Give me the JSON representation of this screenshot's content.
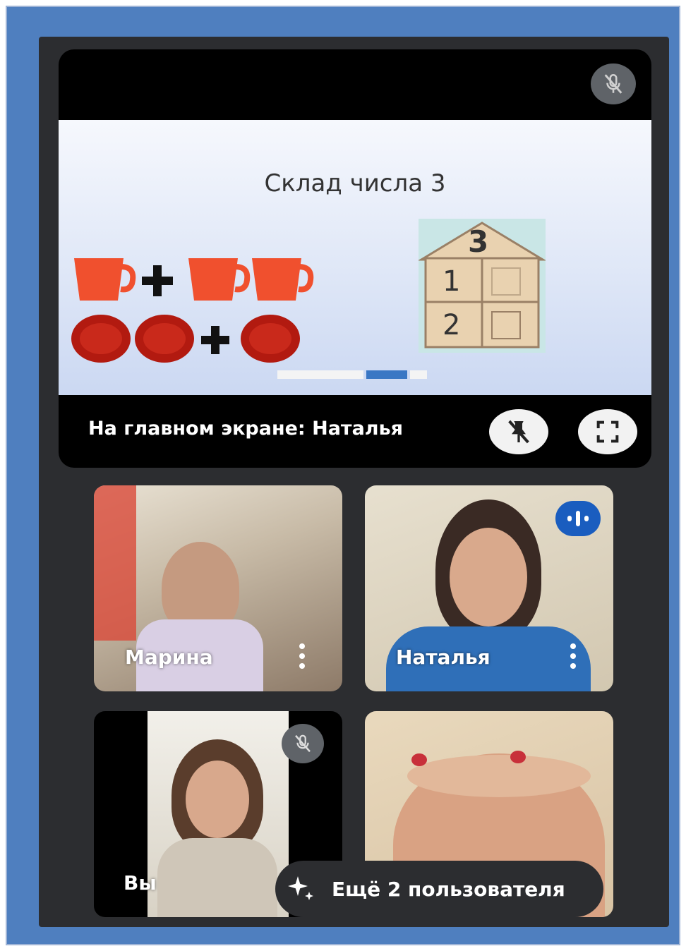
{
  "presentation": {
    "slide_title": "Склад числа 3",
    "house_top_number": "3",
    "house_rows": [
      "1",
      "2"
    ],
    "caption": "На главном экране: Наталья",
    "icons": {
      "top_right": "mic-off-icon",
      "pin": "unpin-icon",
      "fullscreen": "fullscreen-icon"
    }
  },
  "participants": [
    {
      "name": "Марина",
      "icon": "more-options-icon"
    },
    {
      "name": "Наталья",
      "icon": "more-options-icon",
      "status": "speaking"
    },
    {
      "name": "Вы",
      "icon": "mic-off-icon"
    },
    {
      "name": ""
    }
  ],
  "more_users": {
    "label": "Ещё 2 пользователя",
    "icon": "sparkle-icon"
  },
  "colors": {
    "frame_blue": "#4f7fbf",
    "app_bg": "#2c2d30",
    "speaking_blue": "#1a5dbf",
    "cup_red": "#f0502e",
    "plate_red": "#b21a10"
  }
}
